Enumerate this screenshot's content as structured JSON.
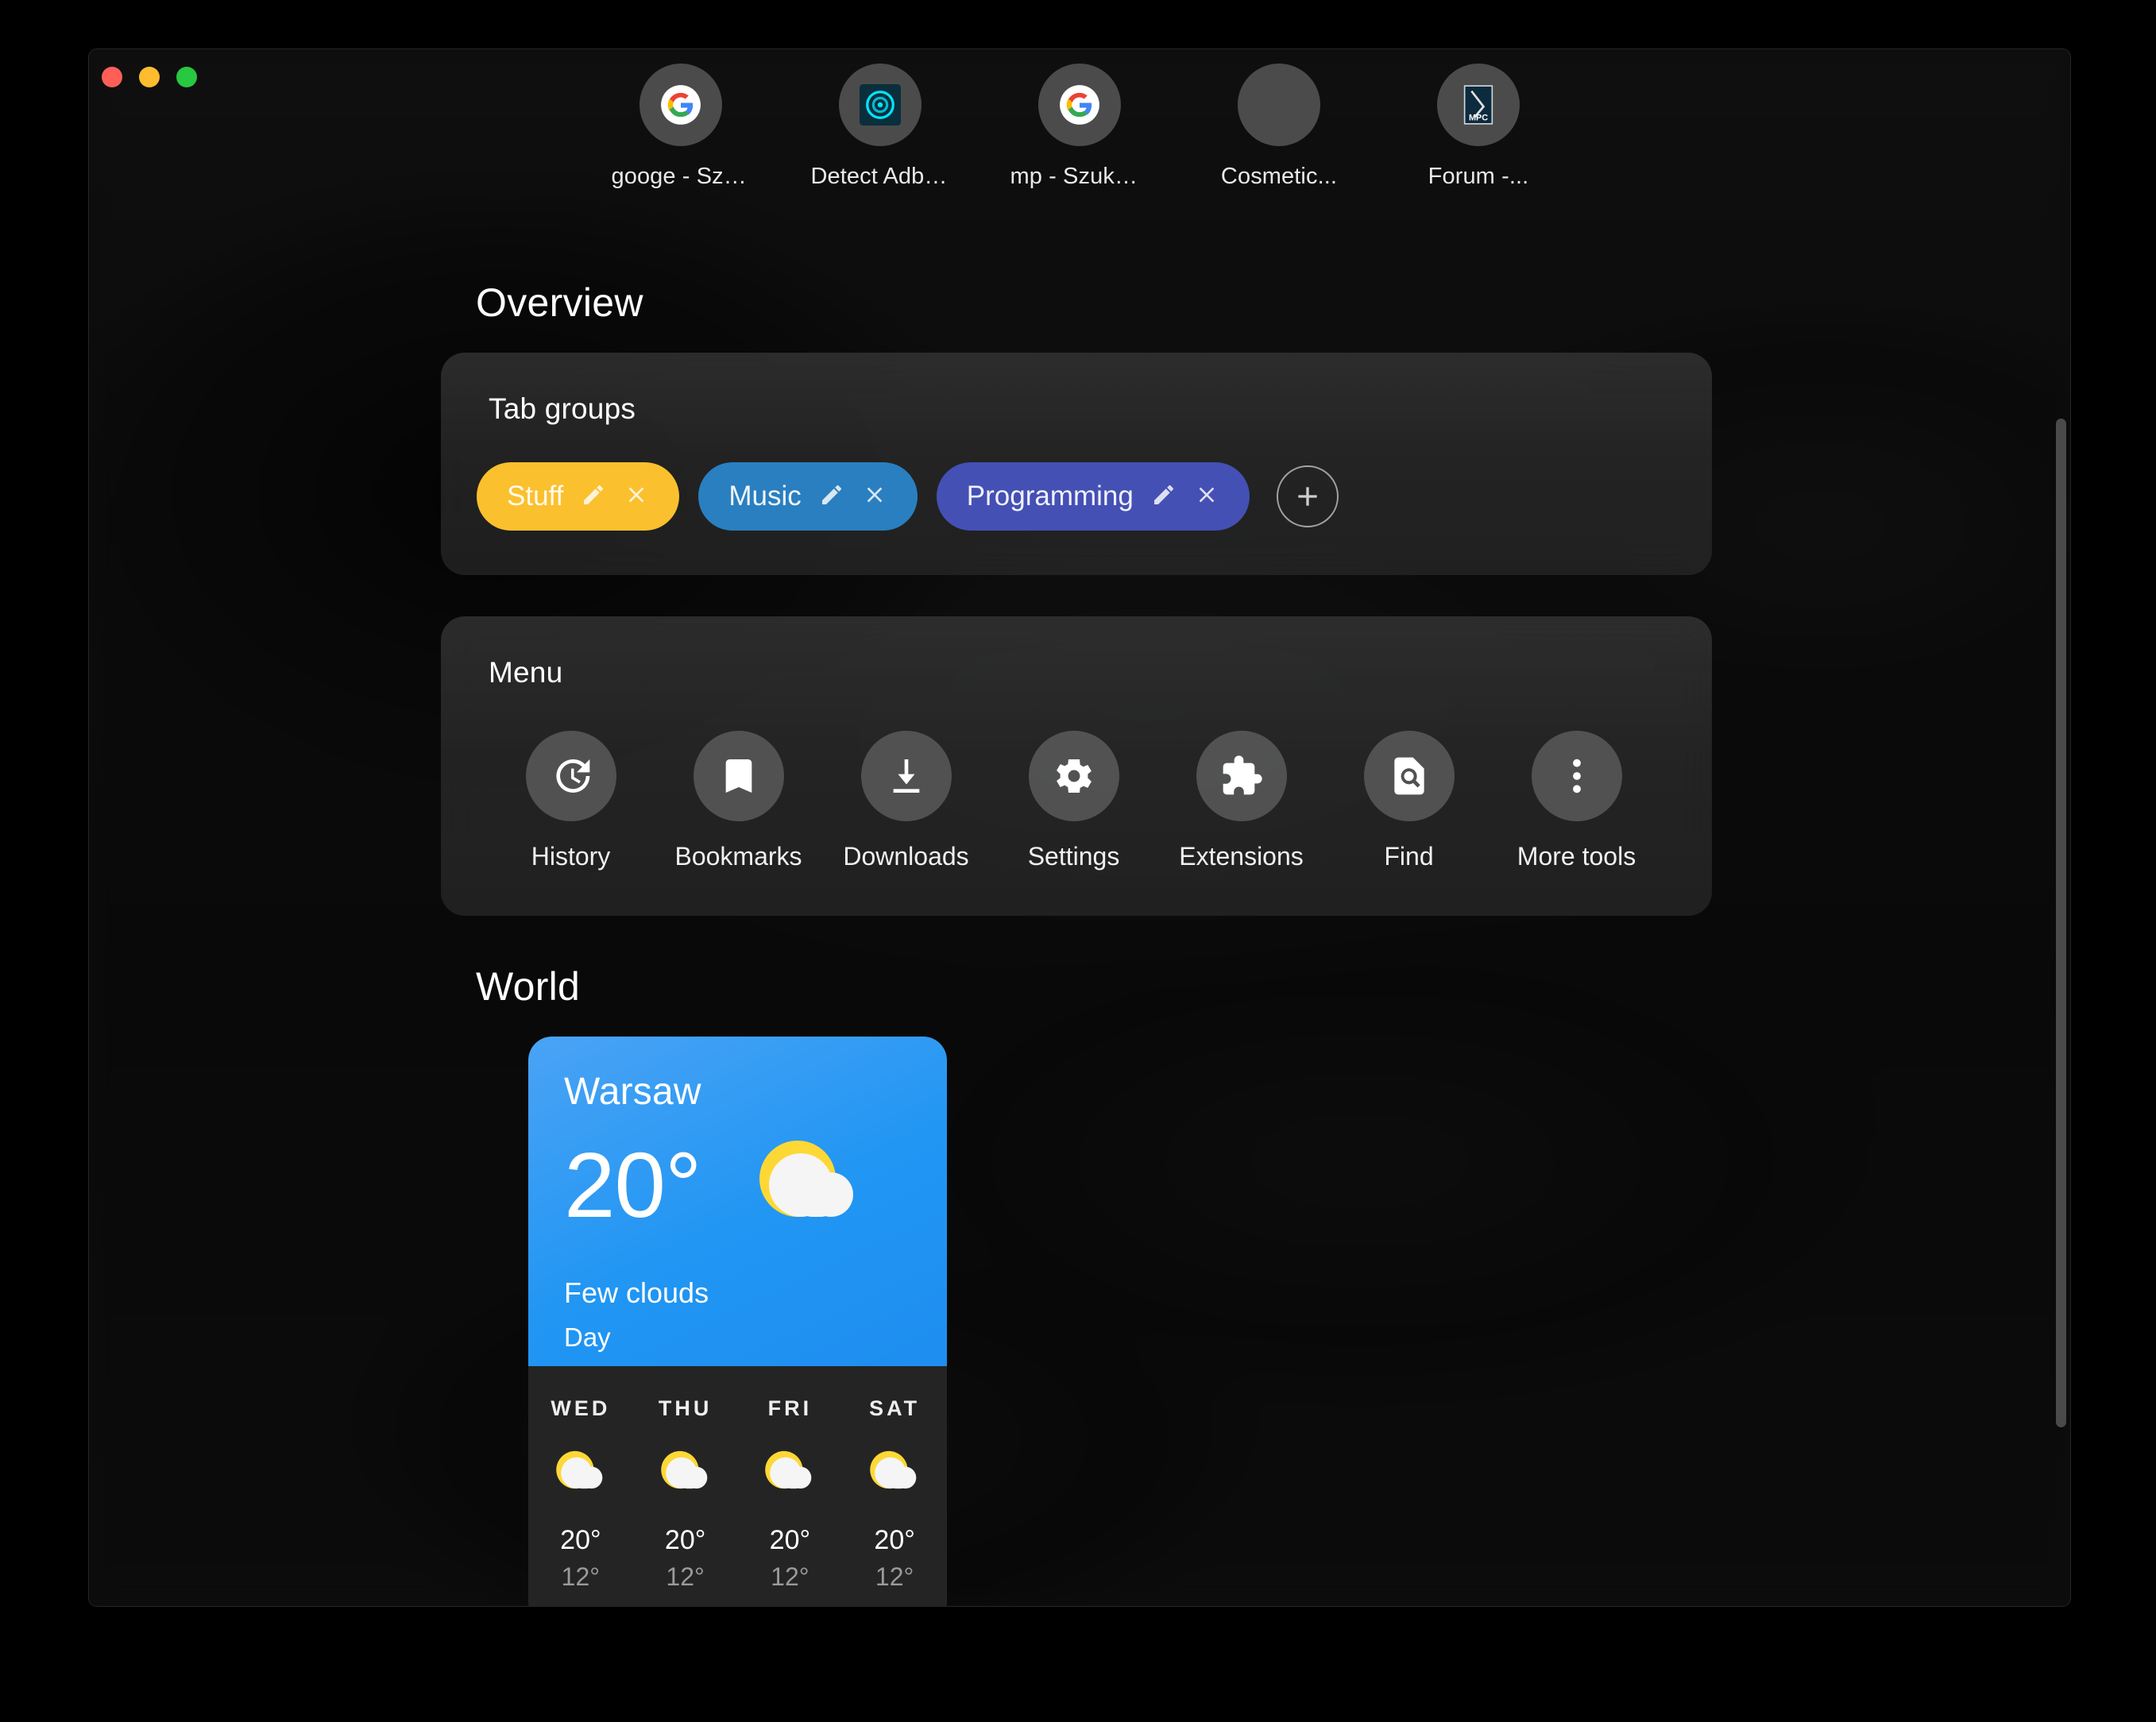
{
  "window": {
    "traffic_lights": [
      {
        "name": "close",
        "color": "#ff5f57"
      },
      {
        "name": "minimize",
        "color": "#febc2e"
      },
      {
        "name": "maximize",
        "color": "#28c840"
      }
    ]
  },
  "tabstrip": {
    "tabs": [
      {
        "label": "googe - Szuk...",
        "icon": "google-icon"
      },
      {
        "label": "Detect Adblo...",
        "icon": "detect-adblock-icon"
      },
      {
        "label": "mp - Szukaj ...",
        "icon": "google-icon"
      },
      {
        "label": "Cosmetic...",
        "icon": "blank-icon"
      },
      {
        "label": "Forum -...",
        "icon": "mpc-icon"
      }
    ]
  },
  "overview": {
    "heading": "Overview",
    "tab_groups": {
      "title": "Tab groups",
      "groups": [
        {
          "label": "Stuff",
          "color": "#fbc02d",
          "edit_icon": "pencil-icon",
          "close_icon": "close-icon"
        },
        {
          "label": "Music",
          "color": "#2a7fc0",
          "edit_icon": "pencil-icon",
          "close_icon": "close-icon"
        },
        {
          "label": "Programming",
          "color": "#4450b4",
          "edit_icon": "pencil-icon",
          "close_icon": "close-icon"
        }
      ],
      "add_label": "+",
      "add_icon": "plus-icon"
    },
    "menu": {
      "title": "Menu",
      "items": [
        {
          "label": "History",
          "icon": "history-icon"
        },
        {
          "label": "Bookmarks",
          "icon": "bookmark-icon"
        },
        {
          "label": "Downloads",
          "icon": "download-icon"
        },
        {
          "label": "Settings",
          "icon": "gear-icon"
        },
        {
          "label": "Extensions",
          "icon": "puzzle-icon"
        },
        {
          "label": "Find",
          "icon": "find-in-page-icon"
        },
        {
          "label": "More tools",
          "icon": "more-vertical-icon"
        }
      ]
    }
  },
  "world": {
    "heading": "World",
    "weather": {
      "city": "Warsaw",
      "temperature": "20°",
      "description": "Few clouds",
      "part_of_day": "Day",
      "condition_icon": "sun-behind-cloud-icon",
      "accent_color": "#2196f3",
      "forecast": [
        {
          "day": "WED",
          "high": "20°",
          "low": "12°",
          "icon": "sun-behind-cloud-icon"
        },
        {
          "day": "THU",
          "high": "20°",
          "low": "12°",
          "icon": "sun-behind-cloud-icon"
        },
        {
          "day": "FRI",
          "high": "20°",
          "low": "12°",
          "icon": "sun-behind-cloud-icon"
        },
        {
          "day": "SAT",
          "high": "20°",
          "low": "12°",
          "icon": "sun-behind-cloud-icon"
        }
      ]
    }
  }
}
